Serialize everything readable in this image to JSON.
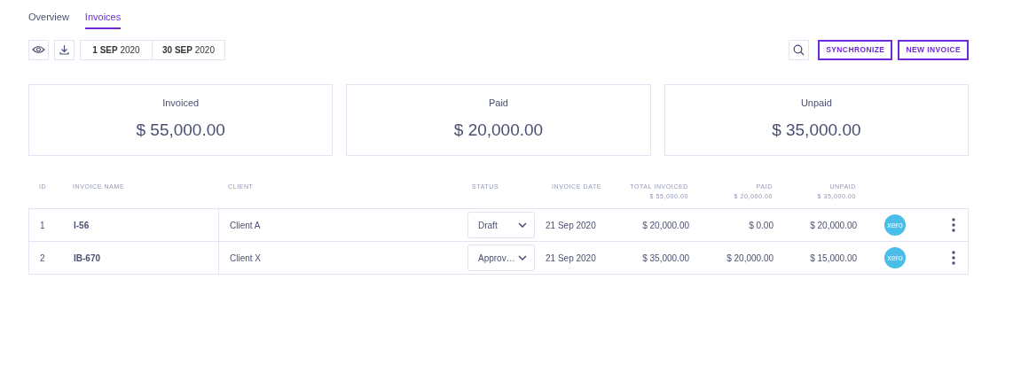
{
  "tabs": [
    {
      "label": "Overview",
      "selected": false
    },
    {
      "label": "Invoices",
      "selected": true
    }
  ],
  "toolbar": {
    "date_from": "**1 SEP** 2020",
    "date_to": "**30 SEP** 2020",
    "buttons": [
      "SYNCHRONIZE",
      "NEW INVOICE"
    ]
  },
  "summary": [
    {
      "label": "Invoiced",
      "value": "$ 55,000.00"
    },
    {
      "label": "Paid",
      "value": "$ 20,000.00"
    },
    {
      "label": "Unpaid",
      "value": "$ 35,000.00"
    }
  ],
  "table": {
    "columns": [
      {
        "label": "ID"
      },
      {
        "label": "INVOICE NAME"
      },
      {
        "label": "CLIENT"
      },
      {
        "label": "STATUS"
      },
      {
        "label": "INVOICE DATE"
      },
      {
        "label": "TOTAL INVOICED",
        "subtotal": "$ 55,000.00"
      },
      {
        "label": "PAID",
        "subtotal": "$ 20,000.00"
      },
      {
        "label": "UNPAID",
        "subtotal": "$ 35,000.00"
      }
    ],
    "rows": [
      {
        "id": "1",
        "name": "I-56",
        "client": "Client A",
        "status": "Draft",
        "date": "21 Sep 2020",
        "total": "$ 20,000.00",
        "paid": "$ 0.00",
        "unpaid": "$ 20,000.00",
        "logo_text": "xero"
      },
      {
        "id": "2",
        "name": "IB-670",
        "client": "Client X",
        "status": "Approv…",
        "date": "21 Sep 2020",
        "total": "$ 35,000.00",
        "paid": "$ 20,000.00",
        "unpaid": "$ 15,000.00",
        "logo_text": "xero"
      }
    ]
  }
}
